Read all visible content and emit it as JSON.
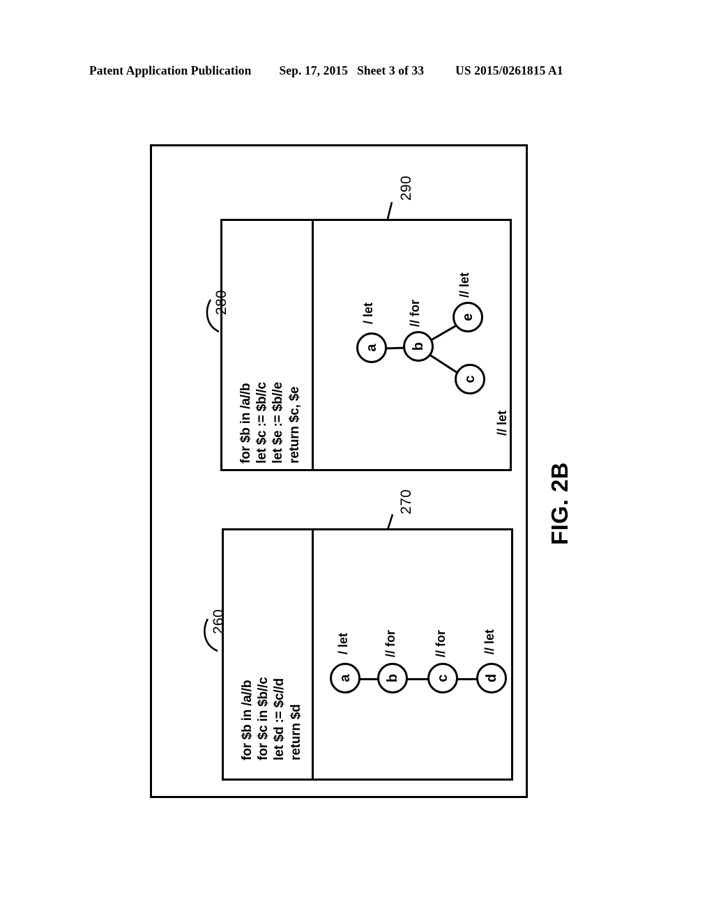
{
  "header": {
    "publication": "Patent Application Publication",
    "date": "Sep. 17, 2015",
    "sheet": "Sheet 3 of 33",
    "patent_number": "US 2015/0261815 A1"
  },
  "figure": {
    "caption": "FIG. 2B",
    "outer_frame_ref": "",
    "panels": [
      {
        "ref": "270",
        "code_ref": "260",
        "code_lines": [
          "for $b in /a//b",
          "for $c in $b//c",
          "let $d := $c//d",
          "return $d"
        ],
        "graph": {
          "nodes": [
            {
              "id": "a",
              "label": "a",
              "axis": "/ let"
            },
            {
              "id": "b",
              "label": "b",
              "axis": "// for"
            },
            {
              "id": "c",
              "label": "c",
              "axis": "// for"
            },
            {
              "id": "d",
              "label": "d",
              "axis": "// let"
            }
          ],
          "edges": [
            {
              "from": "a",
              "to": "b"
            },
            {
              "from": "b",
              "to": "c"
            },
            {
              "from": "c",
              "to": "d"
            }
          ]
        }
      },
      {
        "ref": "290",
        "code_ref": "280",
        "code_lines": [
          "for $b in /a//b",
          "let $c := $b//c",
          "let $e := $b//e",
          "return $c, $e"
        ],
        "graph": {
          "nodes": [
            {
              "id": "a",
              "label": "a",
              "axis": "/ let"
            },
            {
              "id": "b",
              "label": "b",
              "axis": "// for"
            },
            {
              "id": "e",
              "label": "e",
              "axis": "// let"
            },
            {
              "id": "c",
              "label": "c",
              "axis": "// let"
            }
          ],
          "edges": [
            {
              "from": "a",
              "to": "b"
            },
            {
              "from": "b",
              "to": "e"
            },
            {
              "from": "b",
              "to": "c"
            }
          ]
        }
      }
    ]
  },
  "colors": {
    "ink": "#000000",
    "paper": "#ffffff"
  }
}
